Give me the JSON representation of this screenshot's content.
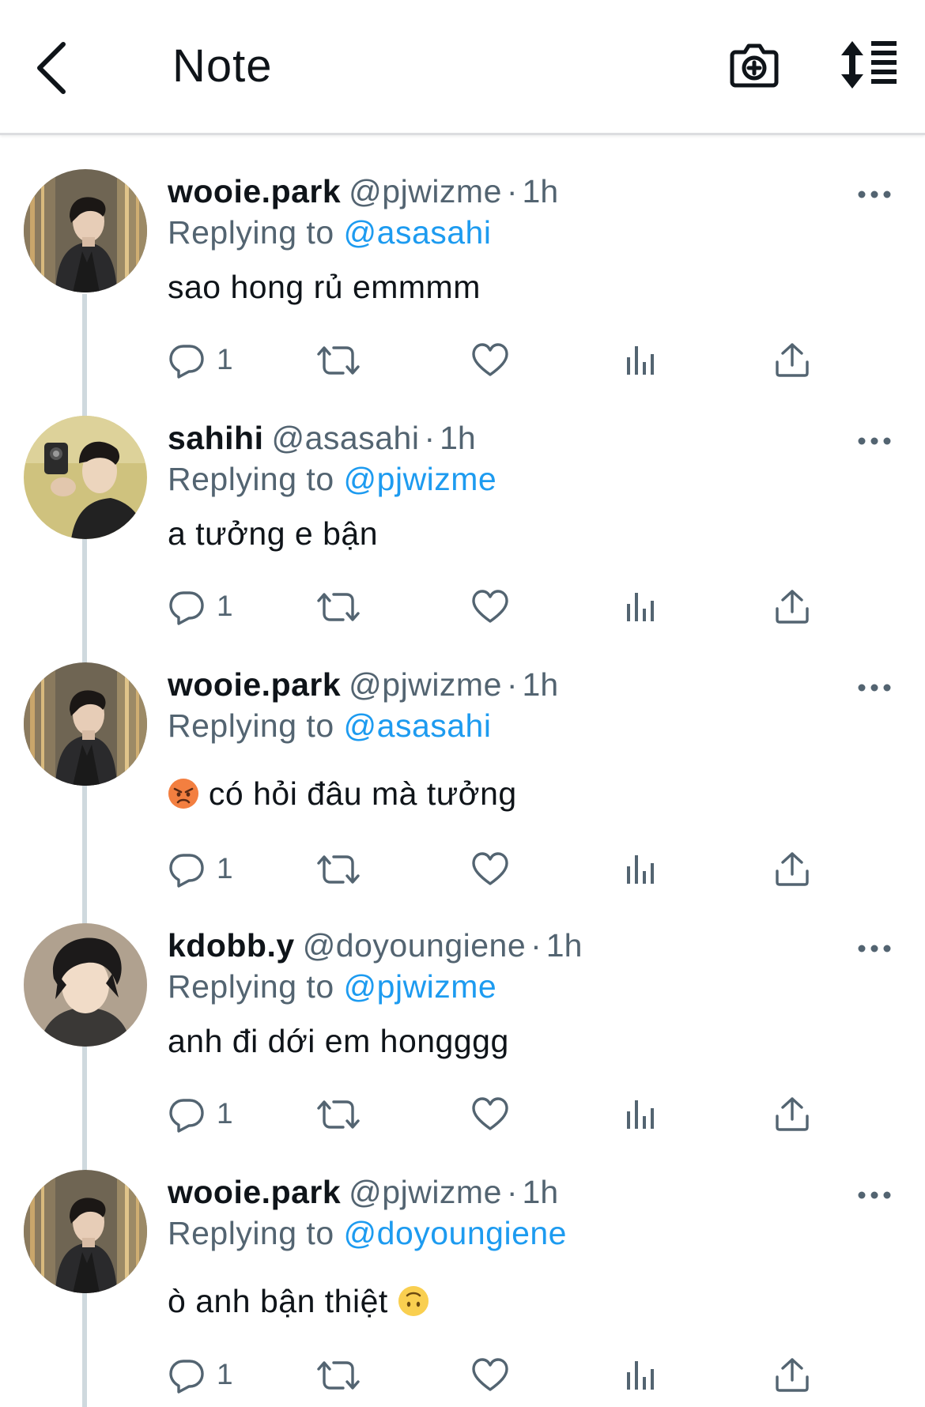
{
  "header": {
    "title": "Note",
    "back_icon": "chevron-left-icon",
    "camera_icon": "camera-plus-icon",
    "sort_icon": "sort-list-icon"
  },
  "colors": {
    "link": "#1d9bf0",
    "secondary_text": "#536471",
    "primary_text": "#0f1419",
    "thread_line": "#cfd9de"
  },
  "tweets": [
    {
      "display_name": "wooie.park",
      "handle": "@pjwizme",
      "time": "1h",
      "replying_label": "Replying to",
      "replying_to": "@asasahi",
      "text": "sao hong rủ emmmm",
      "reply_count": "1",
      "avatar": "avatar-wooie"
    },
    {
      "display_name": "sahihi",
      "handle": "@asasahi",
      "time": "1h",
      "replying_label": "Replying to",
      "replying_to": "@pjwizme",
      "text": "a tưởng e bận",
      "reply_count": "1",
      "avatar": "avatar-sahihi"
    },
    {
      "display_name": "wooie.park",
      "handle": "@pjwizme",
      "time": "1h",
      "replying_label": "Replying to",
      "replying_to": "@asasahi",
      "text": "có hỏi đâu mà tưởng",
      "emoji_before": "angry-face-emoji",
      "reply_count": "1",
      "avatar": "avatar-wooie"
    },
    {
      "display_name": "kdobb.y",
      "handle": "@doyoungiene",
      "time": "1h",
      "replying_label": "Replying to",
      "replying_to": "@pjwizme",
      "text": "anh đi dới em hongggg",
      "reply_count": "1",
      "avatar": "avatar-kdobb"
    },
    {
      "display_name": "wooie.park",
      "handle": "@pjwizme",
      "time": "1h",
      "replying_label": "Replying to",
      "replying_to": "@doyoungiene",
      "text": "ò anh bận thiệt",
      "emoji_after": "upside-down-face-emoji",
      "reply_count": "1",
      "avatar": "avatar-wooie"
    }
  ],
  "action_icons": [
    "reply-icon",
    "retweet-icon",
    "like-icon",
    "analytics-icon",
    "share-icon"
  ]
}
